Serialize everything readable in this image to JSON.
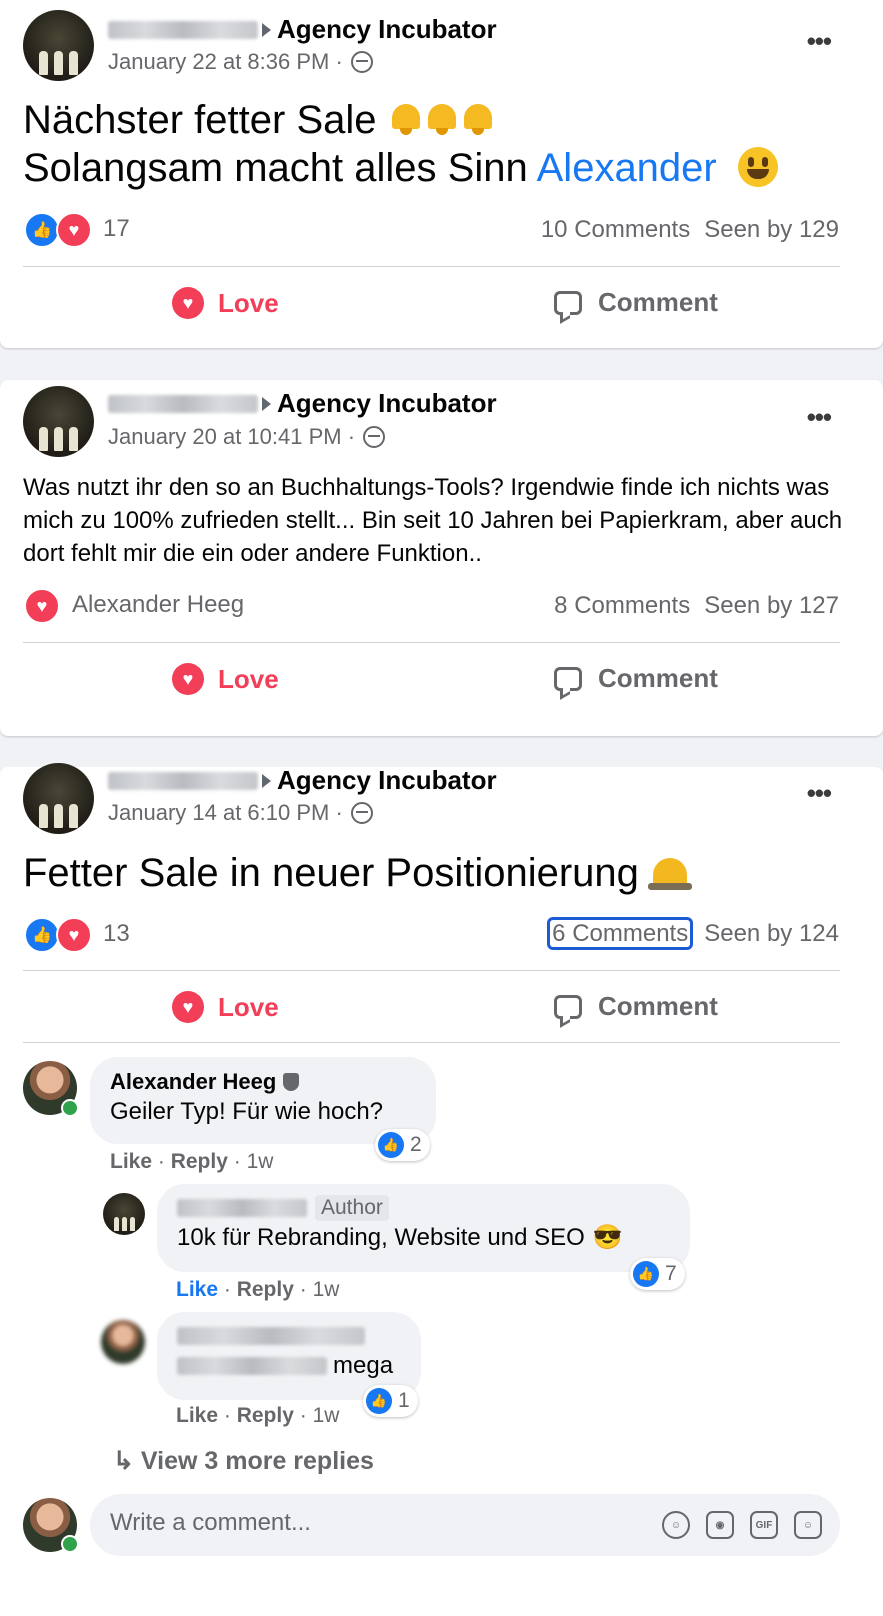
{
  "posts": [
    {
      "group": "Agency Incubator",
      "date": "January 22 at 8:36 PM ·",
      "line1": "Nächster fetter Sale",
      "line2": "Solangsam macht alles Sinn",
      "mention": "Alexander",
      "reactions_count": "17",
      "comments": "10 Comments",
      "seen": "Seen by 129"
    },
    {
      "group": "Agency Incubator",
      "date": "January 20 at 10:41 PM ·",
      "text": "Was nutzt ihr den so an Buchhaltungs-Tools? Irgendwie finde ich nichts was mich zu 100% zufrieden stellt... Bin seit 10 Jahren bei Papierkram, aber auch dort fehlt mir die ein oder andere Funktion..",
      "reactor": "Alexander Heeg",
      "comments": "8 Comments",
      "seen": "Seen by 127"
    },
    {
      "group": "Agency Incubator",
      "date": "January 14 at 6:10 PM ·",
      "line1": "Fetter Sale in neuer Positionierung",
      "reactions_count": "13",
      "comments": "6 Comments",
      "seen": "Seen by 124"
    }
  ],
  "actions": {
    "love": "Love",
    "comment": "Comment"
  },
  "comments": [
    {
      "name": "Alexander Heeg",
      "text": "Geiler Typ! Für wie hoch?",
      "likes": "2",
      "like": "Like",
      "reply": "Reply",
      "time": "1w"
    },
    {
      "badge": "Author",
      "text": "10k für Rebranding, Website und SEO",
      "likes": "7",
      "like": "Like",
      "reply": "Reply",
      "time": "1w"
    },
    {
      "text": "mega",
      "likes": "1",
      "like": "Like",
      "reply": "Reply",
      "time": "1w"
    }
  ],
  "view_more": "View 3 more replies",
  "write_placeholder": "Write a comment...",
  "icons": {
    "gif": "GIF"
  },
  "colors": {
    "love": "#f33e58",
    "like": "#1877f2",
    "mention": "#1877f2"
  }
}
